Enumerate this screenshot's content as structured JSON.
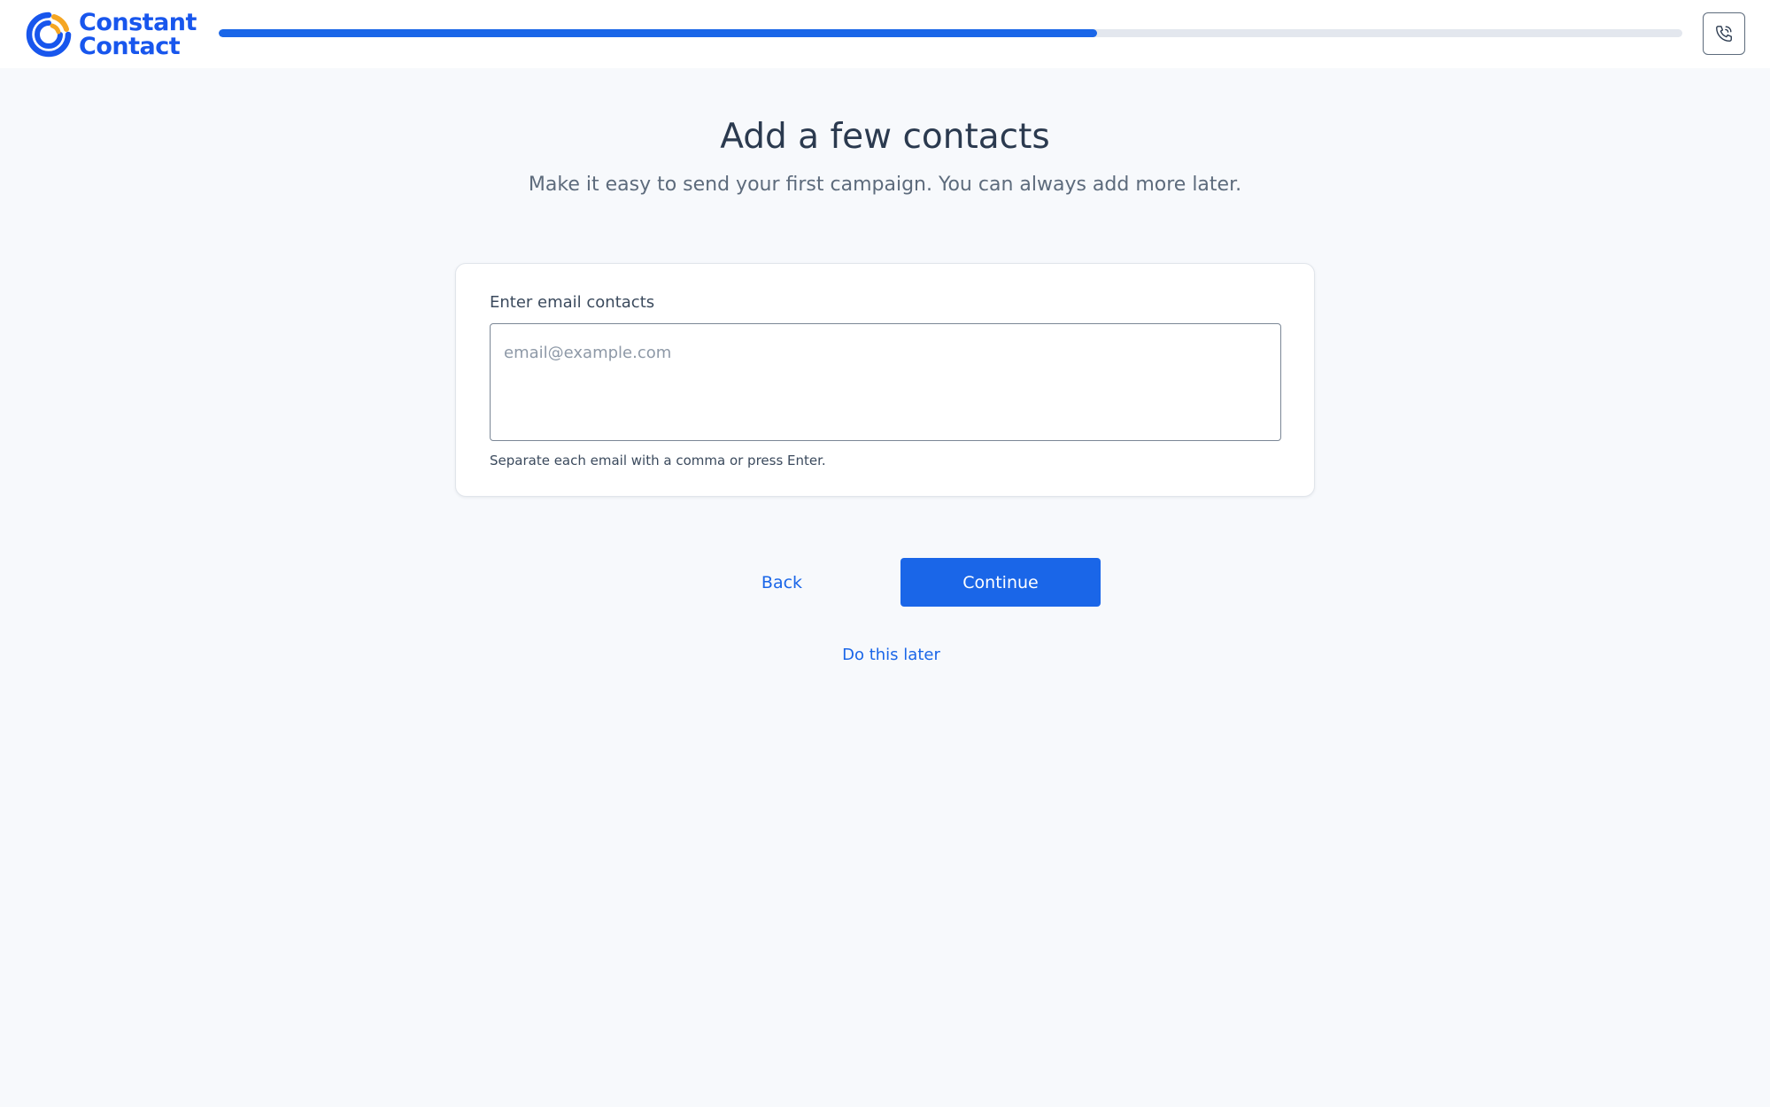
{
  "brand": {
    "name_line1": "Constant",
    "name_line2": "Contact",
    "primary_color": "#1856ed",
    "accent_color": "#f5a623"
  },
  "header": {
    "progress_fraction": 0.6,
    "phone_icon": "phone-icon"
  },
  "main": {
    "title": "Add a few contacts",
    "subtitle": "Make it easy to send your first campaign. You can always add more later."
  },
  "form": {
    "label": "Enter email contacts",
    "value": "",
    "placeholder": "email@example.com",
    "hint": "Separate each email with a comma or press Enter."
  },
  "actions": {
    "back_label": "Back",
    "continue_label": "Continue",
    "later_label": "Do this later"
  }
}
